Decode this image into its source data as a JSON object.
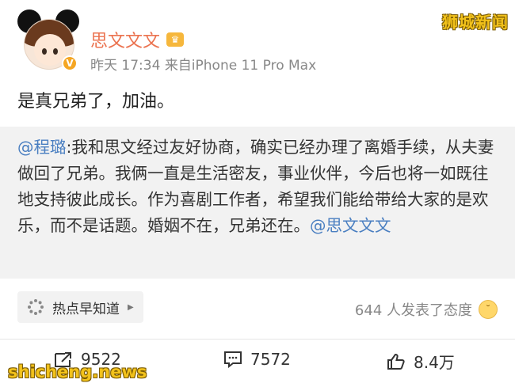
{
  "watermark_top": "狮城新闻",
  "watermark_bottom": "shicheng.news",
  "user": {
    "name": "思文文文",
    "time": "昨天 17:34",
    "source": "来自iPhone 11 Pro Max"
  },
  "post": {
    "text": "是真兄弟了，加油。"
  },
  "repost": {
    "mention_author": "@程璐",
    "text": ":我和思文经过友好协商，确实已经办理了离婚手续，从夫妻做回了兄弟。我俩一直是生活密友，事业伙伴，今后也将一如既往地支持彼此成长。作为喜剧工作者，希望我们能给带给大家的是欢乐，而不是话题。婚姻不在，兄弟还在。",
    "mention_end": "@思文文文"
  },
  "trend": {
    "label": "热点早知道",
    "attitude": "644 人发表了态度"
  },
  "actions": {
    "repost_count": "9522",
    "comment_count": "7572",
    "like_count": "8.4万"
  },
  "colors": {
    "name": "#eb7350",
    "mention": "#4a7fc1",
    "watermark": "#f2c21b"
  }
}
